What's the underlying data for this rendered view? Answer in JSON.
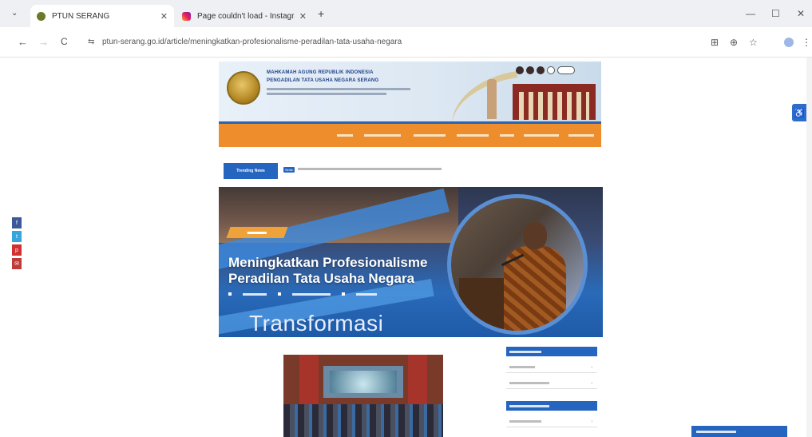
{
  "browser": {
    "tabs": [
      {
        "title": "PTUN SERANG",
        "active": true
      },
      {
        "title": "Page couldn't load - Instagram",
        "active": false
      }
    ],
    "url": "ptun-serang.go.id/article/meningkatkan-profesionalisme-peradilan-tata-usaha-negara",
    "icons": {
      "tab_search": "chevron-down-icon",
      "back": "back-arrow-icon",
      "forward": "forward-arrow-icon",
      "reload": "reload-icon",
      "site_info": "tune-icon",
      "translate": "translate-icon",
      "zoom": "zoom-icon",
      "bookmark": "star-icon",
      "profile": "profile-icon",
      "menu": "kebab-menu-icon"
    },
    "glyphs": {
      "tab_search": "⌄",
      "tab_close": "✕",
      "new_tab": "+",
      "minimize": "—",
      "maximize": "☐",
      "close": "✕",
      "back": "←",
      "forward": "→",
      "reload": "C",
      "site_info": "⇆",
      "translate": "⊞",
      "zoom": "⊕",
      "bookmark": "☆",
      "menu": "⋮"
    }
  },
  "site": {
    "institution_line1": "MAHKAMAH AGUNG REPUBLIK INDONESIA",
    "institution_line2": "PENGADILAN TATA USAHA NEGARA SERANG",
    "ticker_label": "Trending News",
    "ticker_badge": "Berita",
    "accessibility_icon": "accessibility-icon",
    "accessibility_glyph": "♿"
  },
  "hero": {
    "title": "Meningkatkan Profesionalisme Peradilan Tata Usaha Negara",
    "watermark_text": "Transformasi"
  },
  "socials": [
    {
      "icon": "facebook-icon",
      "glyph": "f"
    },
    {
      "icon": "twitter-icon",
      "glyph": "t"
    },
    {
      "icon": "pinterest-icon",
      "glyph": "p"
    },
    {
      "icon": "email-icon",
      "glyph": "✉"
    }
  ],
  "colors": {
    "brand_blue": "#2564bf",
    "nav_orange": "#ee8d2b",
    "accent_gold": "#f0a23a"
  }
}
